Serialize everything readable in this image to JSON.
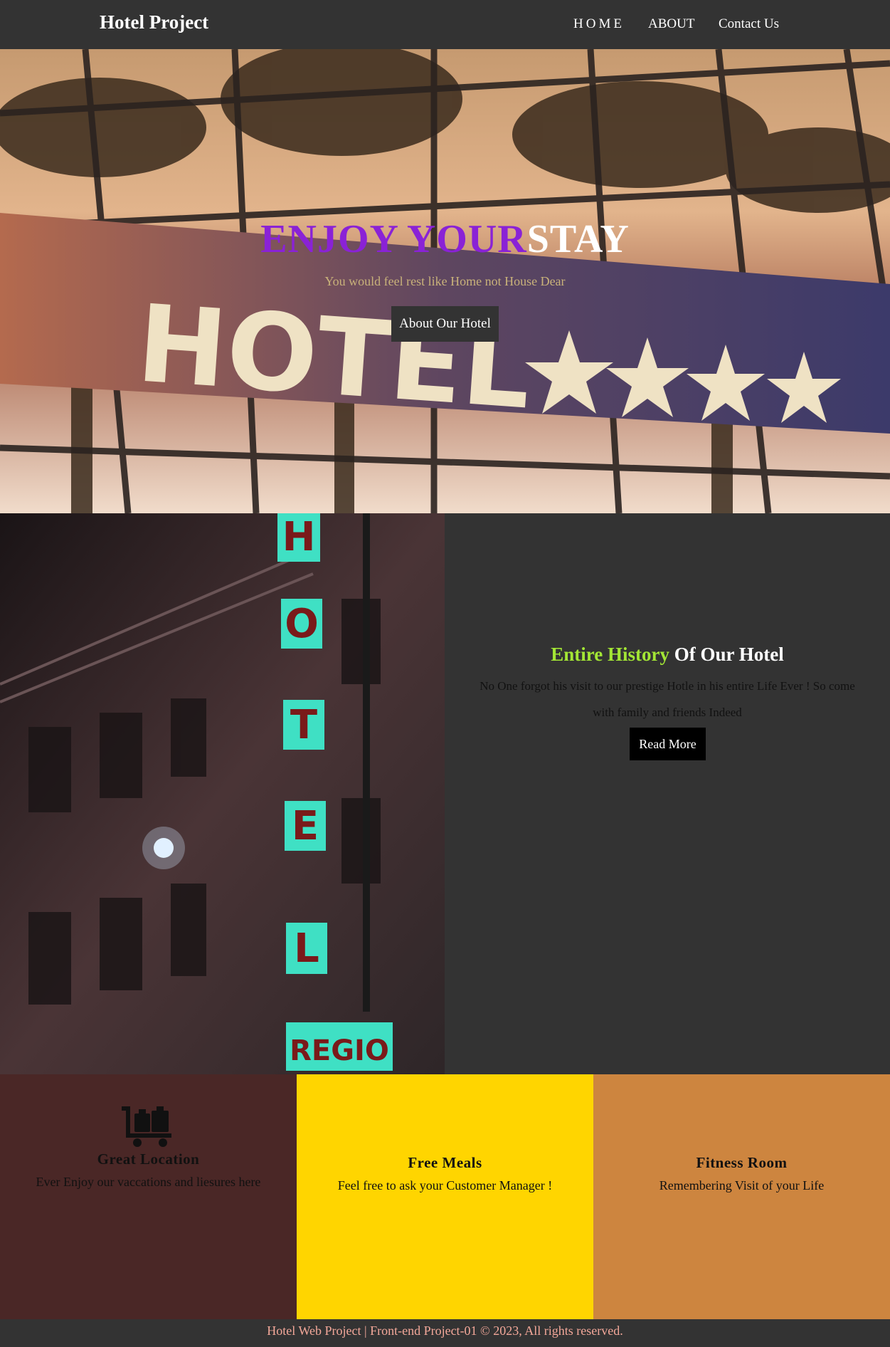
{
  "nav": {
    "brand": "Hotel Project",
    "links": [
      "HOME",
      "ABOUT",
      "Contact Us"
    ]
  },
  "hero": {
    "title_part1": "ENJOY YOUR",
    "title_part2": "STAY",
    "subtitle": "You would feel rest like Home not House Dear",
    "button": "About Our Hotel",
    "sign_text": "HOTEL"
  },
  "history": {
    "title_highlight": "Entire History",
    "title_rest": " Of Our Hotel",
    "description": "No One forgot his visit to our prestige Hotle in his entire Life Ever ! So come with family and friends Indeed",
    "button": "Read More",
    "sign_letters": [
      "H",
      "O",
      "T",
      "E",
      "L"
    ],
    "sign_bottom": "REGIO"
  },
  "features": [
    {
      "icon": "luggage-cart-icon",
      "title": "Great Location",
      "desc": "Ever Enjoy our vaccations and liesures here"
    },
    {
      "title": "Free Meals",
      "desc": "Feel free to ask your Customer Manager !"
    },
    {
      "title": "Fitness Room",
      "desc": "Remembering Visit of your Life"
    }
  ],
  "footer": {
    "text": "Hotel Web Project | Front-end Project-01 © 2023, All rights reserved."
  },
  "colors": {
    "dark": "#333333",
    "purple": "#8a22d6",
    "green": "#a3e635",
    "maroon": "#4a2726",
    "yellow": "#ffd500",
    "orange": "#cd853f",
    "footer_text": "#f4a89a"
  }
}
